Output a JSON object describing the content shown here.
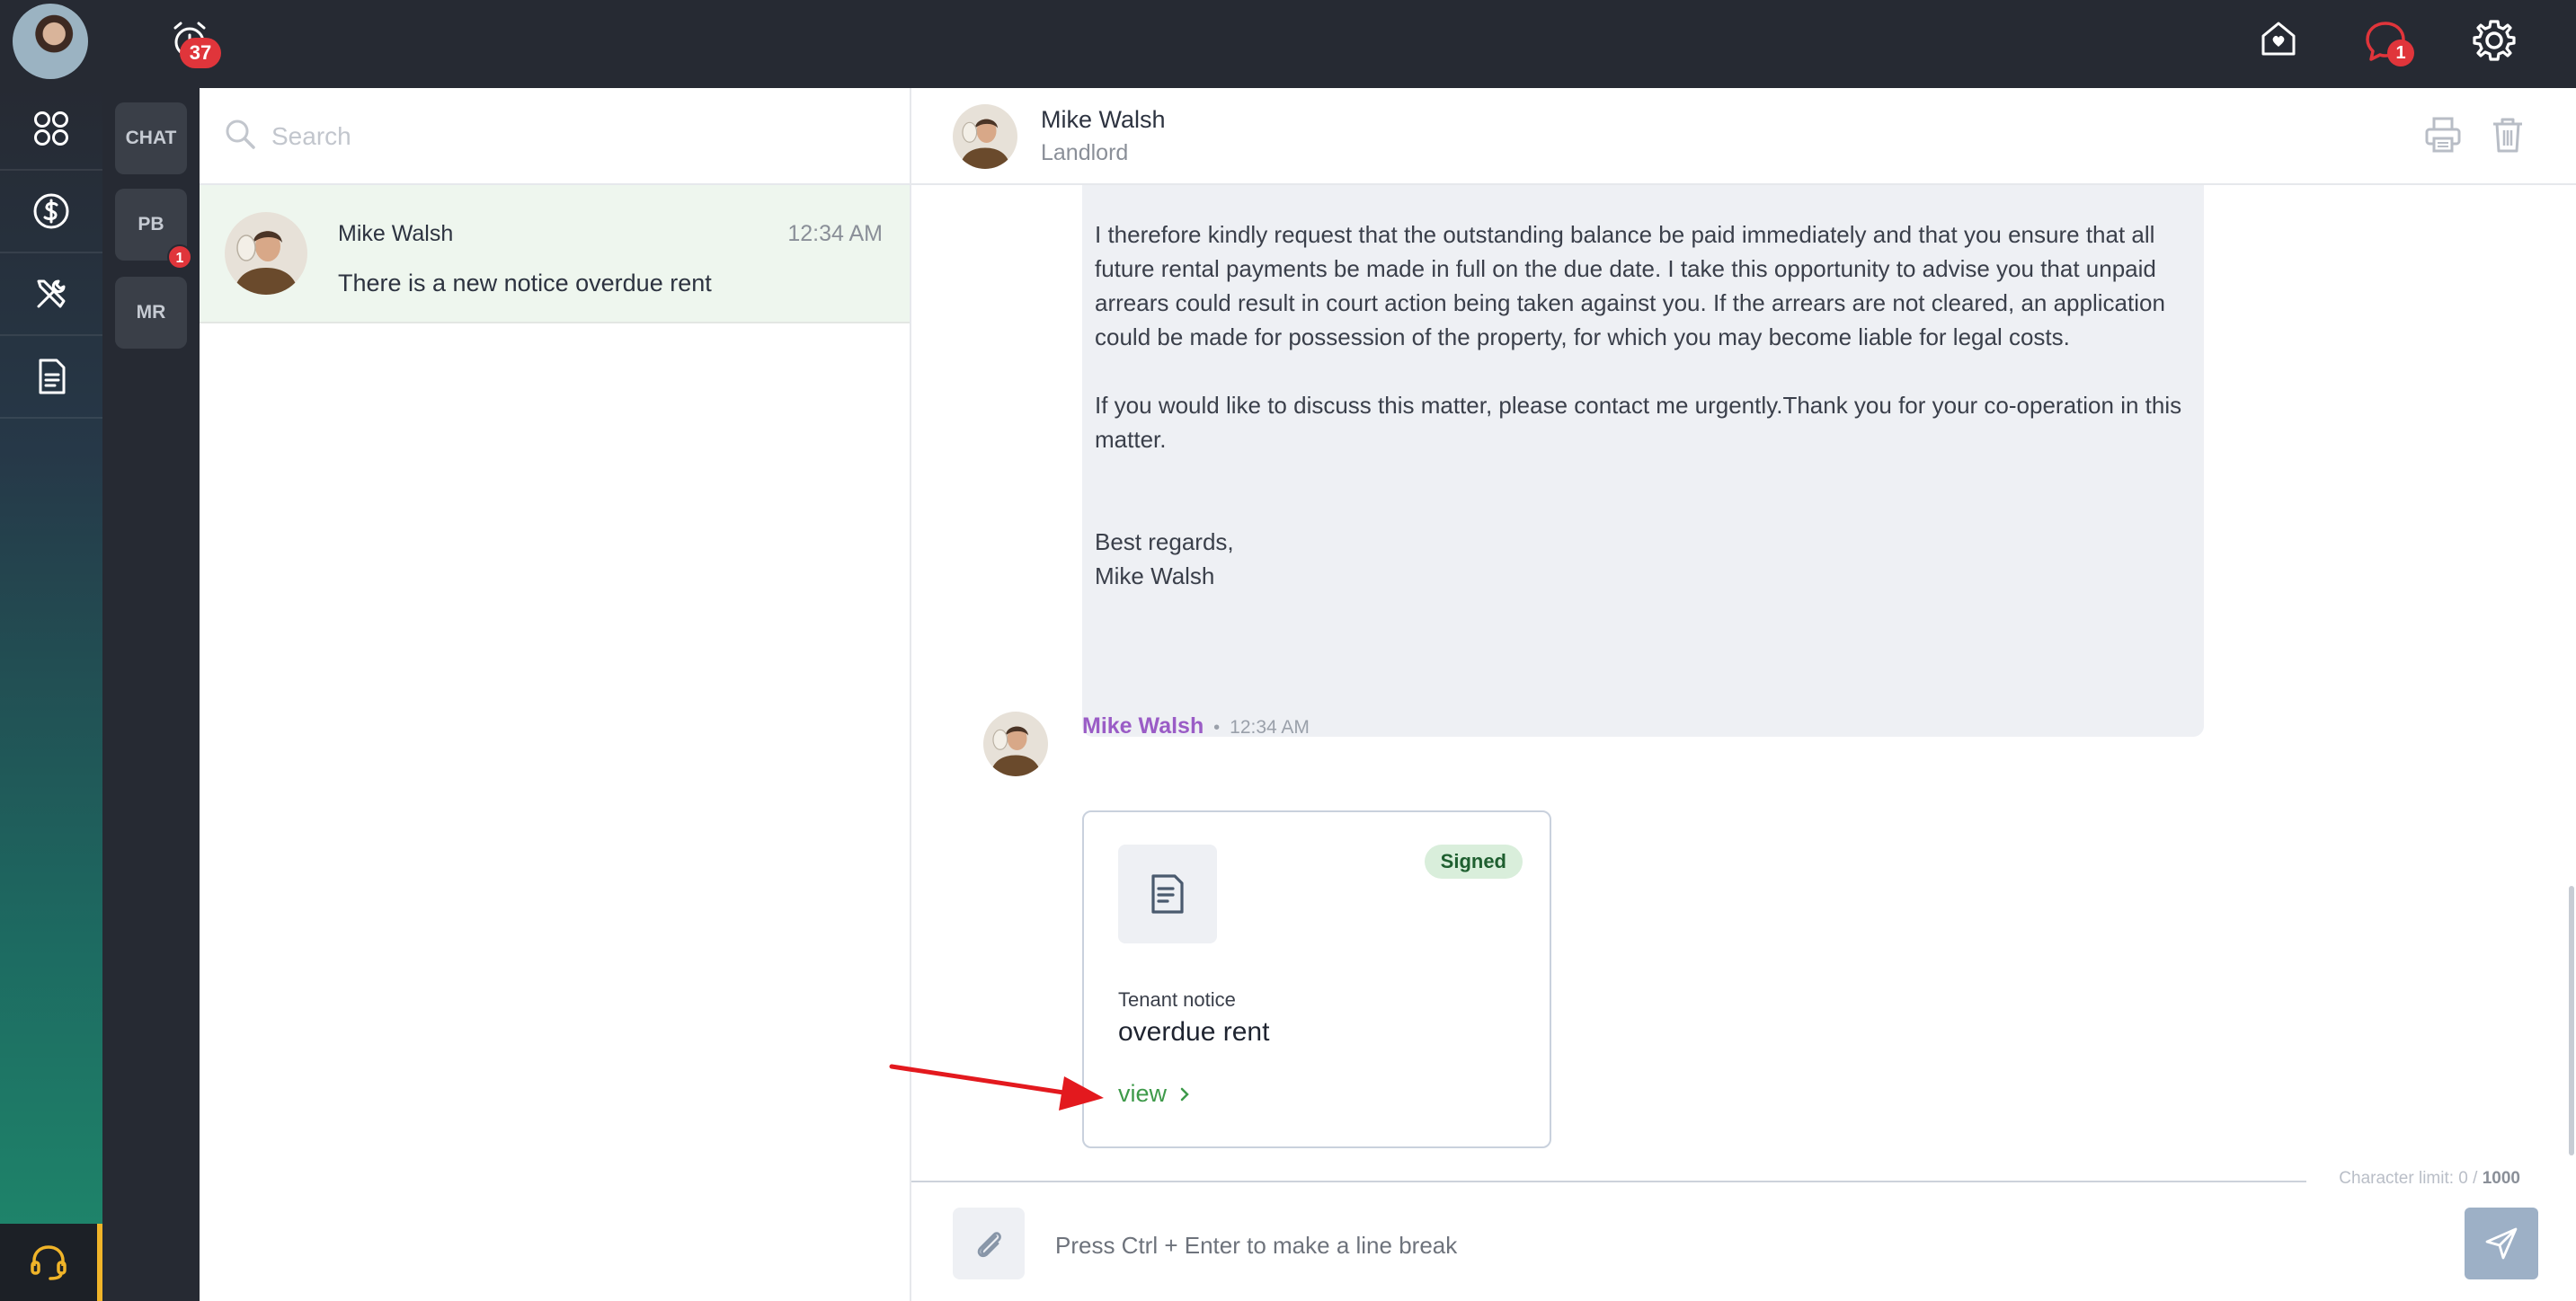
{
  "topbar": {
    "alarm_badge": "37",
    "chat_badge": "1"
  },
  "chat_types": {
    "items": [
      {
        "label": "CHAT"
      },
      {
        "label": "PB",
        "badge": "1"
      },
      {
        "label": "MR"
      }
    ]
  },
  "search": {
    "placeholder": "Search"
  },
  "conversations": [
    {
      "name": "Mike Walsh",
      "time": "12:34 AM",
      "preview": "There is a new notice overdue rent"
    }
  ],
  "chat_header": {
    "name": "Mike Walsh",
    "role": "Landlord"
  },
  "message1": {
    "paragraph1": "I therefore kindly request that the outstanding balance be paid immediately and that you ensure that all future rental payments be made in full on the due date. I take this opportunity to advise you that unpaid arrears could result in court action being taken against you. If the arrears are not cleared, an application could be made for possession of the property, for which you may become liable for legal costs.",
    "paragraph2": "If you would like to discuss this matter, please contact me urgently.Thank you for your co-operation in this matter.",
    "closing": "Best regards,",
    "signature": "Mike Walsh"
  },
  "message2": {
    "sender": "Mike Walsh",
    "time": "12:34 AM",
    "card": {
      "status": "Signed",
      "label": "Tenant notice",
      "title": "overdue rent",
      "link": "view"
    }
  },
  "composer": {
    "char_limit_label": "Character limit: 0 / ",
    "char_limit_max": "1000",
    "placeholder": "Press Ctrl + Enter to make a line break"
  },
  "colors": {
    "topbar": "#262a33",
    "badge": "#e0353b",
    "accent_green": "#3e9a4a",
    "sender_purple": "#9a5cc6",
    "support_accent": "#f0b429",
    "arrow": "#e3191e"
  }
}
